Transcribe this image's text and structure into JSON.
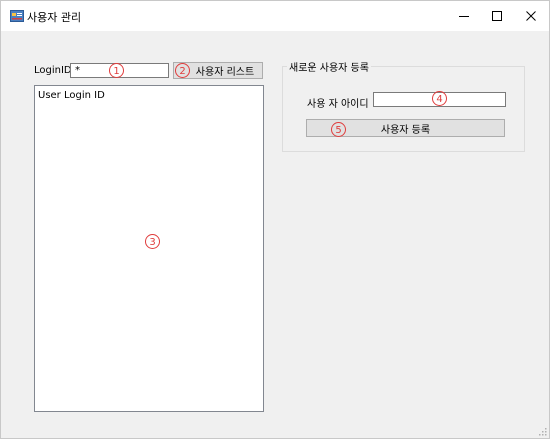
{
  "window": {
    "title": "사용자 관리",
    "min_symbol": "–",
    "close_symbol": "✕",
    "icon": "app-icon"
  },
  "login": {
    "label": "LoginID",
    "value": "*",
    "list_button": "사용자 리스트"
  },
  "list": {
    "items": [
      "User Login ID"
    ]
  },
  "register": {
    "group_title": "새로운 사용자 등록",
    "id_label": "사용 자 아이디",
    "id_value": "",
    "submit_button": "사용자 등록"
  },
  "markers": [
    "1",
    "2",
    "3",
    "4",
    "5"
  ],
  "colors": {
    "marker": "#e03c3c",
    "window_bg": "#f0f0f0",
    "button_bg": "#e1e1e1"
  }
}
